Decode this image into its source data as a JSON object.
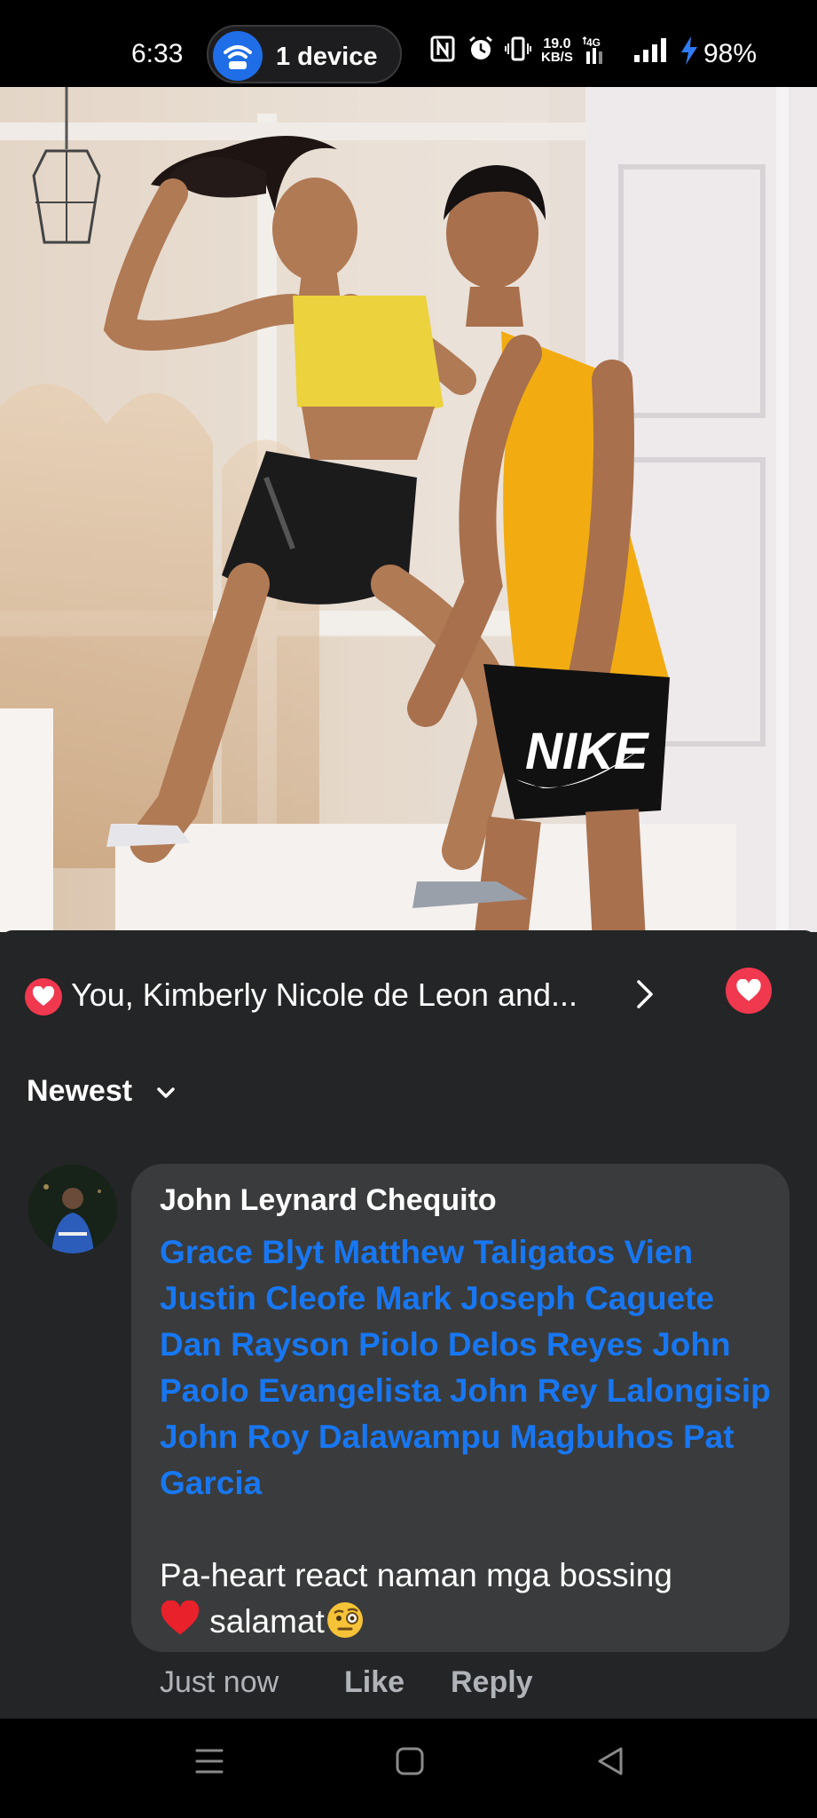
{
  "status_bar": {
    "time": "6:33",
    "hotspot_label": "1 device",
    "net_speed_value": "19.0",
    "net_speed_unit": "KB/S",
    "network_type": "4G",
    "battery": "98%",
    "icons": [
      "nfc-icon",
      "alarm-icon",
      "vibrate-icon",
      "network-4g-icon",
      "signal-icon",
      "charging-icon"
    ]
  },
  "post": {
    "photo_shirt_text": "NIKE"
  },
  "reactions": {
    "summary": "You, Kimberly Nicole de Leon and...",
    "reaction_type": "heart",
    "heart_color": "#f0384f"
  },
  "sort": {
    "label": "Newest"
  },
  "comment": {
    "author": "John Leynard Chequito",
    "tags": [
      "Grace Blyt",
      "Matthew Taligatos",
      "Vien Justin Cleofe",
      "Mark Joseph Caguete",
      "Dan Rayson",
      "Piolo Delos Reyes",
      "John Paolo Evangelista",
      "John Rey Lalongisip",
      "John Roy Dalawampu Magbuhos",
      "Pat Garcia"
    ],
    "text": "Pa-heart react naman mga bossing",
    "text_end": "salamat",
    "time": "Just now",
    "like_label": "Like",
    "reply_label": "Reply",
    "tag_color": "#1877f2"
  },
  "nav": {
    "icons": [
      "menu-icon",
      "home-icon",
      "back-icon"
    ]
  }
}
